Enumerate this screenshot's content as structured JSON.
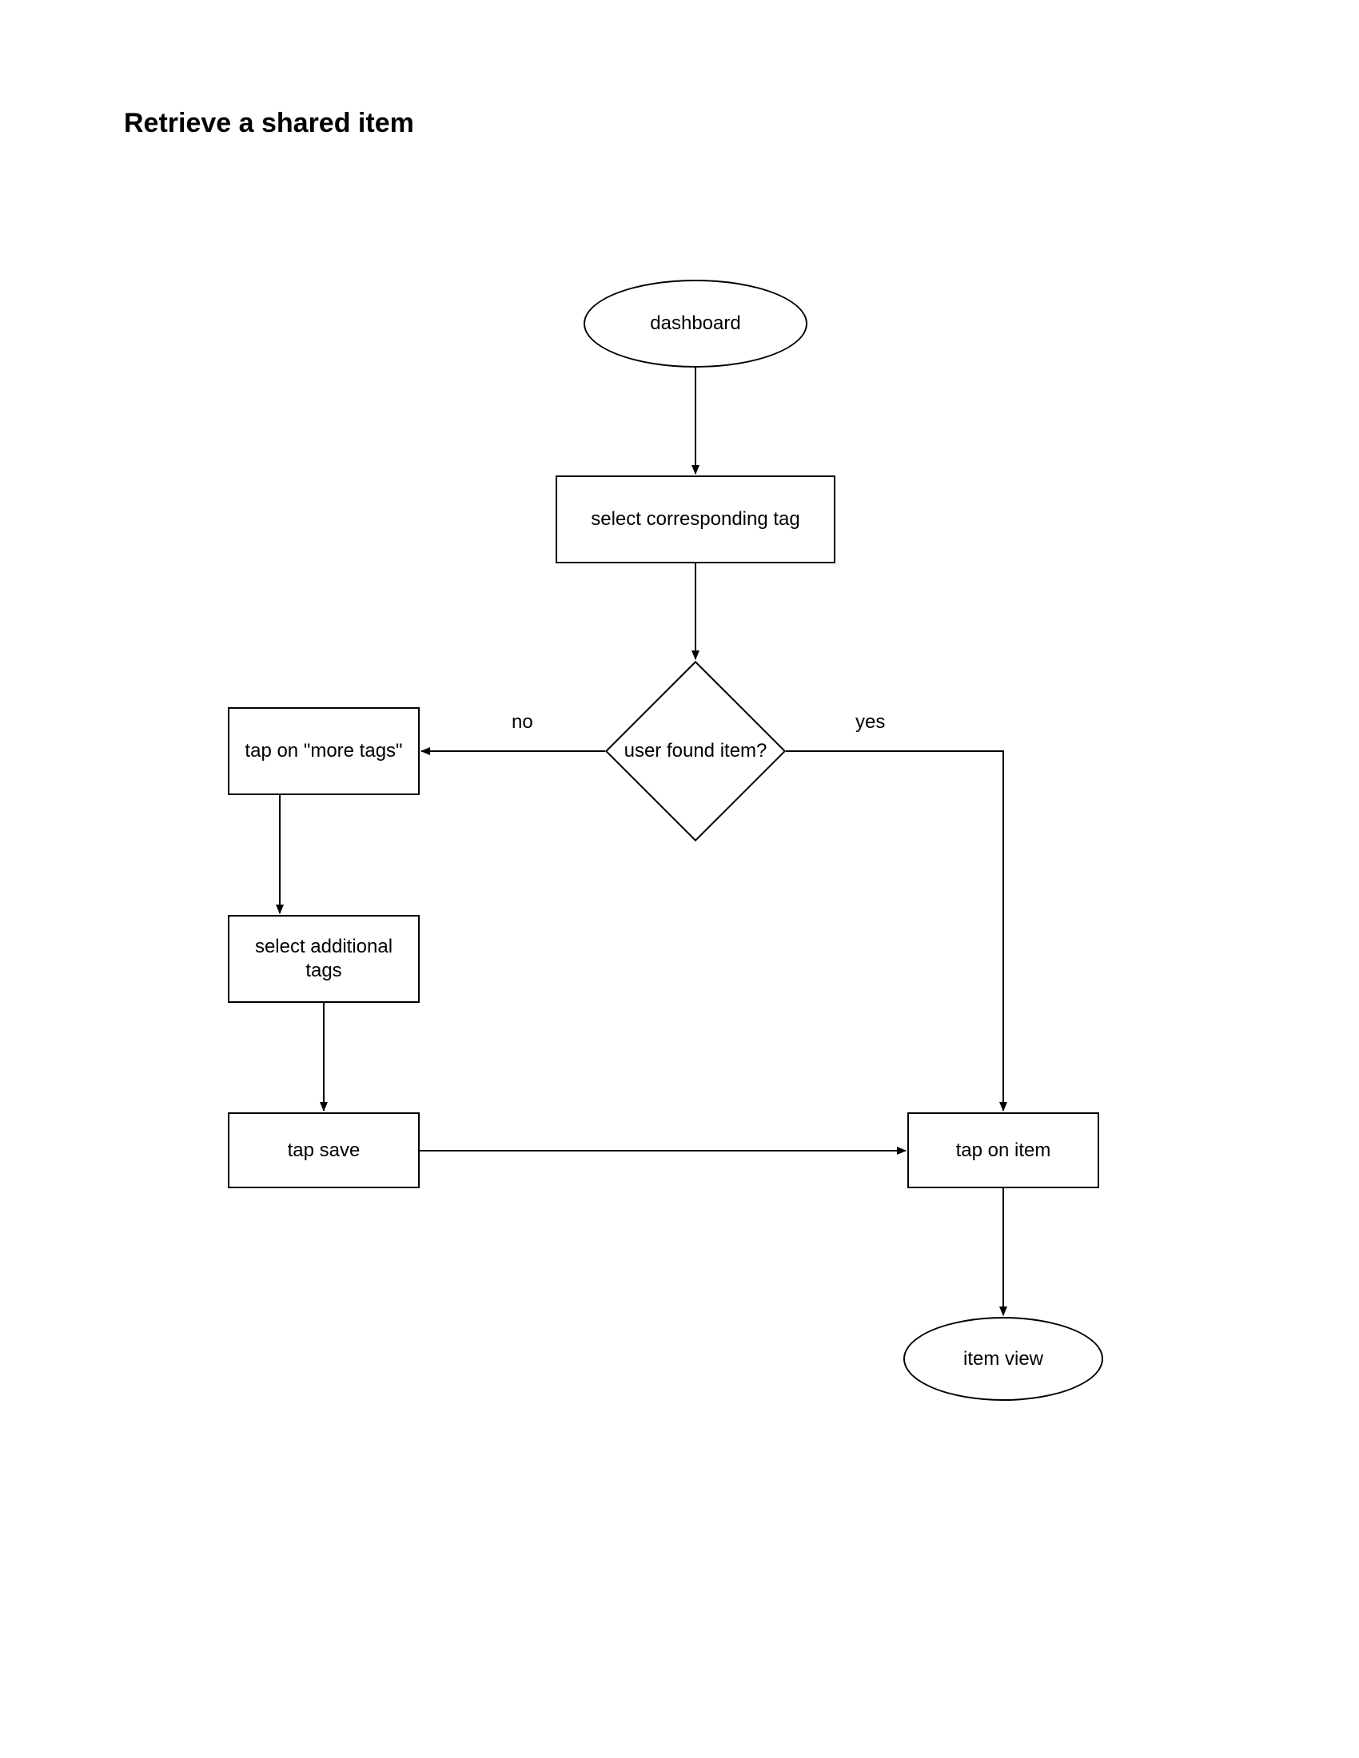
{
  "title": "Retrieve a shared item",
  "nodes": {
    "dashboard": "dashboard",
    "select_tag": "select corresponding tag",
    "decision": "user found item?",
    "more_tags": "tap on \"more tags\"",
    "additional_tags": "select additional tags",
    "tap_save": "tap save",
    "tap_item": "tap on item",
    "item_view": "item view"
  },
  "edges": {
    "no": "no",
    "yes": "yes"
  }
}
